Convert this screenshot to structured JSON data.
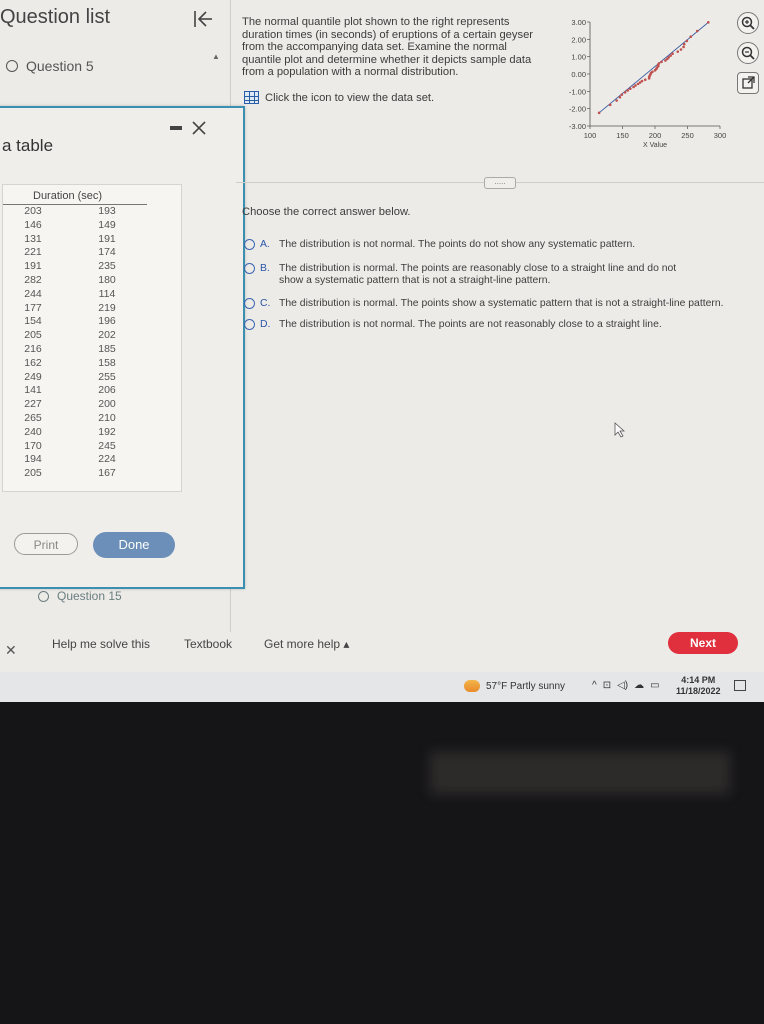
{
  "sidebar": {
    "title": "Question list",
    "question5": "Question 5",
    "question15": "Question 15"
  },
  "popup": {
    "title": "a table",
    "column_header": "Duration (sec)",
    "rows": [
      [
        "203",
        "193"
      ],
      [
        "146",
        "149"
      ],
      [
        "131",
        "191"
      ],
      [
        "221",
        "174"
      ],
      [
        "191",
        "235"
      ],
      [
        "282",
        "180"
      ],
      [
        "244",
        "114"
      ],
      [
        "177",
        "219"
      ],
      [
        "154",
        "196"
      ],
      [
        "205",
        "202"
      ],
      [
        "216",
        "185"
      ],
      [
        "162",
        "158"
      ],
      [
        "249",
        "255"
      ],
      [
        "141",
        "206"
      ],
      [
        "227",
        "200"
      ],
      [
        "265",
        "210"
      ],
      [
        "240",
        "192"
      ],
      [
        "170",
        "245"
      ],
      [
        "194",
        "224"
      ],
      [
        "205",
        "167"
      ]
    ],
    "print_label": "Print",
    "done_label": "Done"
  },
  "question": {
    "prompt": "The normal quantile plot shown to the right represents duration times (in seconds) of eruptions of a certain geyser from the accompanying data set. Examine the normal quantile plot and determine whether it depicts sample data from a population with a normal distribution.",
    "dataset_link": "Click the icon to view the data set.",
    "choose": "Choose the correct answer below.",
    "options": [
      {
        "letter": "A.",
        "text": "The distribution is not normal. The points do not show any systematic pattern."
      },
      {
        "letter": "B.",
        "text": "The distribution is normal. The points are reasonably close to a straight line and do not show a systematic pattern that is not a straight-line pattern."
      },
      {
        "letter": "C.",
        "text": "The distribution is normal. The points show a systematic pattern that is not a straight-line pattern."
      },
      {
        "letter": "D.",
        "text": "The distribution is not normal. The points are not reasonably close to a straight line."
      }
    ],
    "more_button": "....."
  },
  "chart_data": {
    "type": "scatter",
    "xlabel": "X Value",
    "ylabel": "",
    "xlim": [
      100,
      300
    ],
    "ylim": [
      -3,
      3
    ],
    "x_ticks": [
      "100",
      "150",
      "200",
      "250",
      "300"
    ],
    "y_ticks": [
      "3.00",
      "2.00",
      "1.00",
      "0.00",
      "-1.00",
      "-2.00",
      "-3.00"
    ],
    "x": [
      114,
      131,
      141,
      146,
      149,
      154,
      158,
      162,
      167,
      170,
      174,
      177,
      180,
      185,
      191,
      191,
      192,
      193,
      194,
      196,
      200,
      202,
      203,
      205,
      205,
      206,
      210,
      216,
      219,
      221,
      224,
      227,
      235,
      240,
      244,
      245,
      249,
      255,
      265,
      282
    ],
    "y": [
      -2.24,
      -1.78,
      -1.53,
      -1.34,
      -1.19,
      -1.06,
      -0.95,
      -0.85,
      -0.75,
      -0.66,
      -0.57,
      -0.49,
      -0.41,
      -0.33,
      -0.25,
      -0.17,
      -0.09,
      -0.02,
      0.06,
      0.13,
      0.21,
      0.29,
      0.37,
      0.45,
      0.53,
      0.61,
      0.7,
      0.78,
      0.87,
      0.96,
      1.06,
      1.17,
      1.29,
      1.41,
      1.56,
      1.72,
      1.91,
      2.15,
      2.48,
      2.98
    ],
    "point_color": "#c0504d",
    "line_color": "#3a5da0"
  },
  "bottom": {
    "help": "Help me solve this",
    "textbook": "Textbook",
    "more_help": "Get more help",
    "next": "Next"
  },
  "taskbar": {
    "weather": "57°F  Partly sunny",
    "time": "4:14 PM",
    "date": "11/18/2022"
  },
  "icons": {
    "zoom_in": "zoom-in-icon",
    "zoom_out": "zoom-out-icon",
    "popout": "external-link-icon"
  }
}
